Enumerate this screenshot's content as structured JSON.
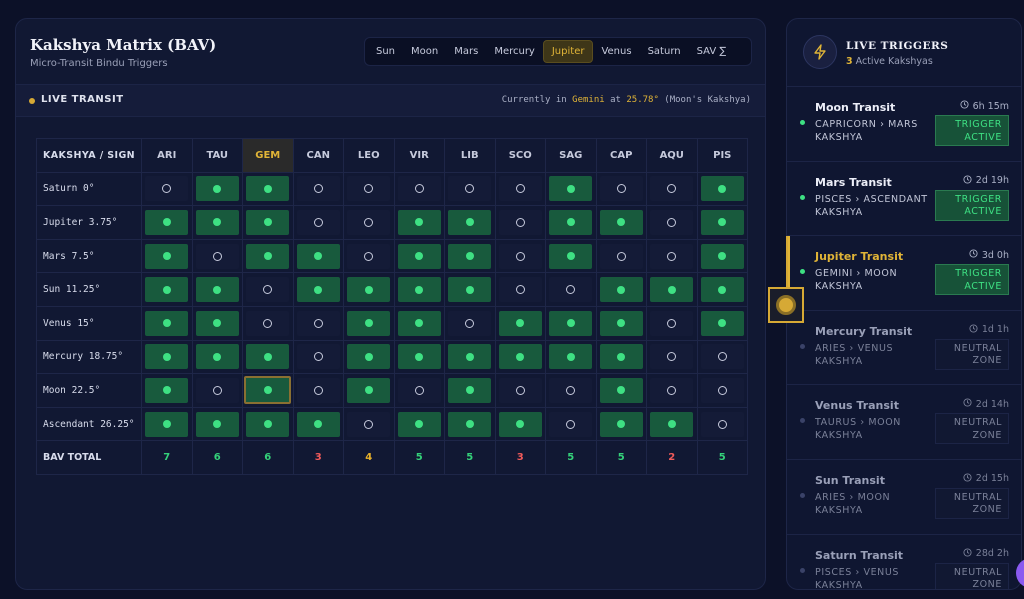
{
  "header": {
    "title": "Kakshya Matrix (BAV)",
    "subtitle": "Micro-Transit Bindu Triggers",
    "planet_tabs": [
      "Sun",
      "Moon",
      "Mars",
      "Mercury",
      "Jupiter",
      "Venus",
      "Saturn",
      "SAV ∑"
    ],
    "active_tab": "Jupiter"
  },
  "transit": {
    "label": "LIVE TRANSIT",
    "prefix": "Currently in ",
    "sign": "Gemini",
    "mid": " at ",
    "degree": "25.78°",
    "suffix": " (Moon's Kakshya)"
  },
  "matrix": {
    "corner": "KAKSHYA / SIGN",
    "columns": [
      "ARI",
      "TAU",
      "GEM",
      "CAN",
      "LEO",
      "VIR",
      "LIB",
      "SCO",
      "SAG",
      "CAP",
      "AQU",
      "PIS"
    ],
    "selected_column": "GEM",
    "rows": [
      {
        "label": "Saturn 0°",
        "bindus": [
          0,
          1,
          1,
          0,
          0,
          0,
          0,
          0,
          1,
          0,
          0,
          1
        ]
      },
      {
        "label": "Jupiter 3.75°",
        "bindus": [
          1,
          1,
          1,
          0,
          0,
          1,
          1,
          0,
          1,
          1,
          0,
          1
        ]
      },
      {
        "label": "Mars 7.5°",
        "bindus": [
          1,
          0,
          1,
          1,
          0,
          1,
          1,
          0,
          1,
          0,
          0,
          1
        ]
      },
      {
        "label": "Sun 11.25°",
        "bindus": [
          1,
          1,
          0,
          1,
          1,
          1,
          1,
          0,
          0,
          1,
          1,
          1
        ]
      },
      {
        "label": "Venus 15°",
        "bindus": [
          1,
          1,
          0,
          0,
          1,
          1,
          0,
          1,
          1,
          1,
          0,
          1
        ]
      },
      {
        "label": "Mercury 18.75°",
        "bindus": [
          1,
          1,
          1,
          0,
          1,
          1,
          1,
          1,
          1,
          1,
          0,
          0
        ]
      },
      {
        "label": "Moon 22.5°",
        "bindus": [
          1,
          0,
          1,
          0,
          1,
          0,
          1,
          0,
          0,
          1,
          0,
          0
        ]
      },
      {
        "label": "Ascendant 26.25°",
        "bindus": [
          1,
          1,
          1,
          1,
          0,
          1,
          1,
          1,
          0,
          1,
          1,
          0
        ]
      }
    ],
    "highlight": {
      "row": 6,
      "col": 2
    },
    "totals_label": "BAV TOTAL",
    "totals": [
      7,
      6,
      6,
      3,
      4,
      5,
      5,
      3,
      5,
      5,
      2,
      5
    ],
    "total_colors": [
      "green",
      "green",
      "green",
      "red",
      "amber",
      "green",
      "green",
      "red",
      "green",
      "green",
      "red",
      "green"
    ]
  },
  "live_triggers": {
    "title": "LIVE TRIGGERS",
    "count": "3",
    "count_suffix": " Active Kakshyas",
    "items": [
      {
        "name": "Moon Transit",
        "path_from": "CAPRICORN",
        "path_to": "MARS",
        "path_suffix": "KAKSHYA",
        "time": "6h 15m",
        "status": "TRIGGER ACTIVE",
        "state": "active"
      },
      {
        "name": "Mars Transit",
        "path_from": "PISCES",
        "path_to": "ASCENDANT",
        "path_suffix": "KAKSHYA",
        "time": "2d 19h",
        "status": "TRIGGER ACTIVE",
        "state": "active"
      },
      {
        "name": "Jupiter Transit",
        "path_from": "GEMINI",
        "path_to": "MOON",
        "path_suffix": "KAKSHYA",
        "time": "3d 0h",
        "status": "TRIGGER ACTIVE",
        "state": "selected"
      },
      {
        "name": "Mercury Transit",
        "path_from": "ARIES",
        "path_to": "VENUS",
        "path_suffix": "KAKSHYA",
        "time": "1d 1h",
        "status": "NEUTRAL ZONE",
        "state": "neutral"
      },
      {
        "name": "Venus Transit",
        "path_from": "TAURUS",
        "path_to": "MOON",
        "path_suffix": "KAKSHYA",
        "time": "2d 14h",
        "status": "NEUTRAL ZONE",
        "state": "neutral"
      },
      {
        "name": "Sun Transit",
        "path_from": "ARIES",
        "path_to": "MOON",
        "path_suffix": "KAKSHYA",
        "time": "2d 15h",
        "status": "NEUTRAL ZONE",
        "state": "neutral"
      },
      {
        "name": "Saturn Transit",
        "path_from": "PISCES",
        "path_to": "VENUS",
        "path_suffix": "KAKSHYA",
        "time": "28d 2h",
        "status": "NEUTRAL ZONE",
        "state": "neutral"
      }
    ]
  },
  "colors": {
    "accent": "#e0b437",
    "bindu_on": "#185a3d",
    "bindu_dot": "#3ee083",
    "red": "#f05a5a",
    "amber": "#e8b12a"
  }
}
